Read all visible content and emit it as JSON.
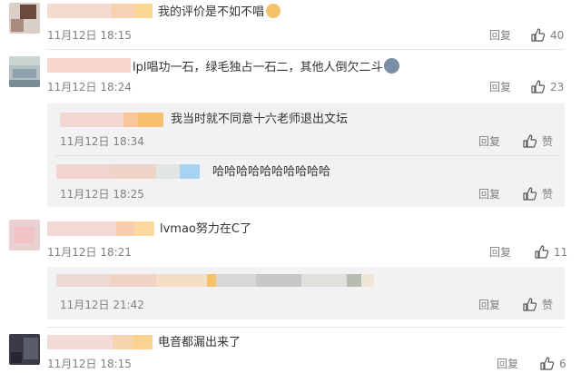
{
  "comments": [
    {
      "text": "我的评价是不如不唱",
      "time": "11月12日 18:15",
      "reply": "回复",
      "likes": "40",
      "emoji": "doge-emoji"
    },
    {
      "text": "lpl唱功一石，绿毛独占一石二，其他人倒欠二斗",
      "time": "11月12日 18:24",
      "reply": "回复",
      "likes": "23",
      "emoji": "husky-emoji"
    },
    {
      "text": "lvmao努力在C了",
      "time": "11月12日 18:21",
      "reply": "回复",
      "likes": "11"
    },
    {
      "text": "电音都漏出来了",
      "time": "11月12日 18:15",
      "reply": "回复",
      "likes": "6"
    }
  ],
  "replies": [
    {
      "text": "我当时就不同意十六老师退出文坛",
      "time": "11月12日 18:34",
      "reply": "回复",
      "like_label": "赞"
    },
    {
      "text": "哈哈哈哈哈哈哈哈哈哈",
      "time": "11月12日 18:25",
      "reply": "回复",
      "like_label": "赞"
    },
    {
      "text": "",
      "time": "11月12日 21:42",
      "reply": "回复",
      "like_label": "赞"
    }
  ],
  "colors": {
    "link": "#333333",
    "meta": "#808080",
    "subbox": "#f2f2f5"
  }
}
